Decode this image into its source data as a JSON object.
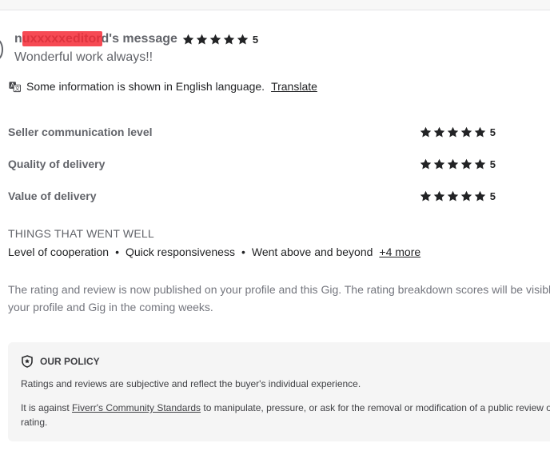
{
  "message": {
    "author": "nuxxxxxeditord",
    "author_visible_tail": "'s message",
    "author_full_label": "n       d's message",
    "rating": "5",
    "body": "Wonderful work always!!"
  },
  "language_notice": {
    "text": "Some information is shown in English language.",
    "translate_label": "Translate"
  },
  "breakdown": [
    {
      "label": "Seller communication level",
      "rating": "5"
    },
    {
      "label": "Quality of delivery",
      "rating": "5"
    },
    {
      "label": "Value of delivery",
      "rating": "5"
    }
  ],
  "went_well": {
    "title": "THINGS THAT WENT WELL",
    "items": [
      "Level of cooperation",
      "Quick responsiveness",
      "Went above and beyond"
    ],
    "more_label": "+4 more"
  },
  "publish_note": "The rating and review is now published on your profile and this Gig. The rating breakdown scores will be visible on your profile and Gig in the coming weeks.",
  "policy": {
    "title": "OUR POLICY",
    "p1": "Ratings and reviews are subjective and reflect the buyer's individual experience.",
    "p2_prefix": "It is against ",
    "p2_link": "Fiverr's Community Standards",
    "p2_suffix": " to manipulate, pressure, or ask for the removal or modification of a public review or rating."
  },
  "colors": {
    "star": "#222325",
    "redaction": "#f42a36",
    "policy_bg": "#f5f5f5"
  }
}
